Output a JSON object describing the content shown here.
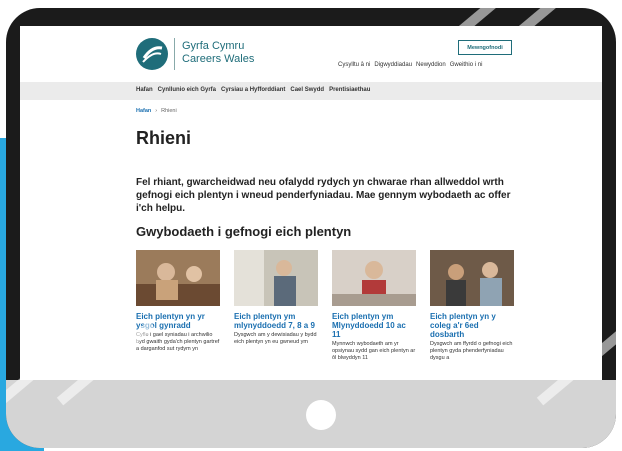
{
  "header": {
    "logo_line1": "Gyrfa Cymru",
    "logo_line2": "Careers Wales",
    "login_label": "Mewngofnodi",
    "util_links": [
      "Cysylltu â ni",
      "Digwyddiadau",
      "Newyddion",
      "Gweithio i ni"
    ]
  },
  "main_nav": [
    "Hafan",
    "Cynllunio eich Gyrfa",
    "Cyrsiau a Hyfforddiant",
    "Cael Swydd",
    "Prentisiaethau"
  ],
  "breadcrumb": {
    "home": "Hafan",
    "separator": "›",
    "current": "Rhieni"
  },
  "page": {
    "title": "Rhieni",
    "intro": "Fel rhiant, gwarcheidwad neu ofalydd rydych yn chwarae rhan allweddol wrth gefnogi eich plentyn i wneud penderfyniadau. Mae gennym wybodaeth ac offer i'ch helpu.",
    "section_title": "Gwybodaeth i gefnogi eich plentyn"
  },
  "cards": [
    {
      "title": "Eich plentyn yn yr ysgol gynradd",
      "desc": "Cyfle i gael syniadau i archwilio byd gwaith gyda'ch plentyn gartref a darganfod sut rydym yn"
    },
    {
      "title": "Eich plentyn ym mlynyddoedd 7, 8 a 9",
      "desc": "Dysgwch am y dewisiadau y bydd eich plentyn yn eu gwneud ym"
    },
    {
      "title": "Eich plentyn ym Mlynyddoedd 10 ac 11",
      "desc": "Mynnwch wybodaeth am yr opsiynau sydd gan eich plentyn ar ôl blwyddyn 11"
    },
    {
      "title": "Eich plentyn yn y coleg a'r 6ed dosbarth",
      "desc": "Dysgwch am ffyrdd o gefnogi eich plentyn gyda phenderfyniadau dysgu a"
    }
  ],
  "colors": {
    "brand_teal": "#1f6d7a",
    "link_blue": "#1a6fb0",
    "bezel": "#1b1b1b",
    "accent_blue": "#29a8e0"
  }
}
